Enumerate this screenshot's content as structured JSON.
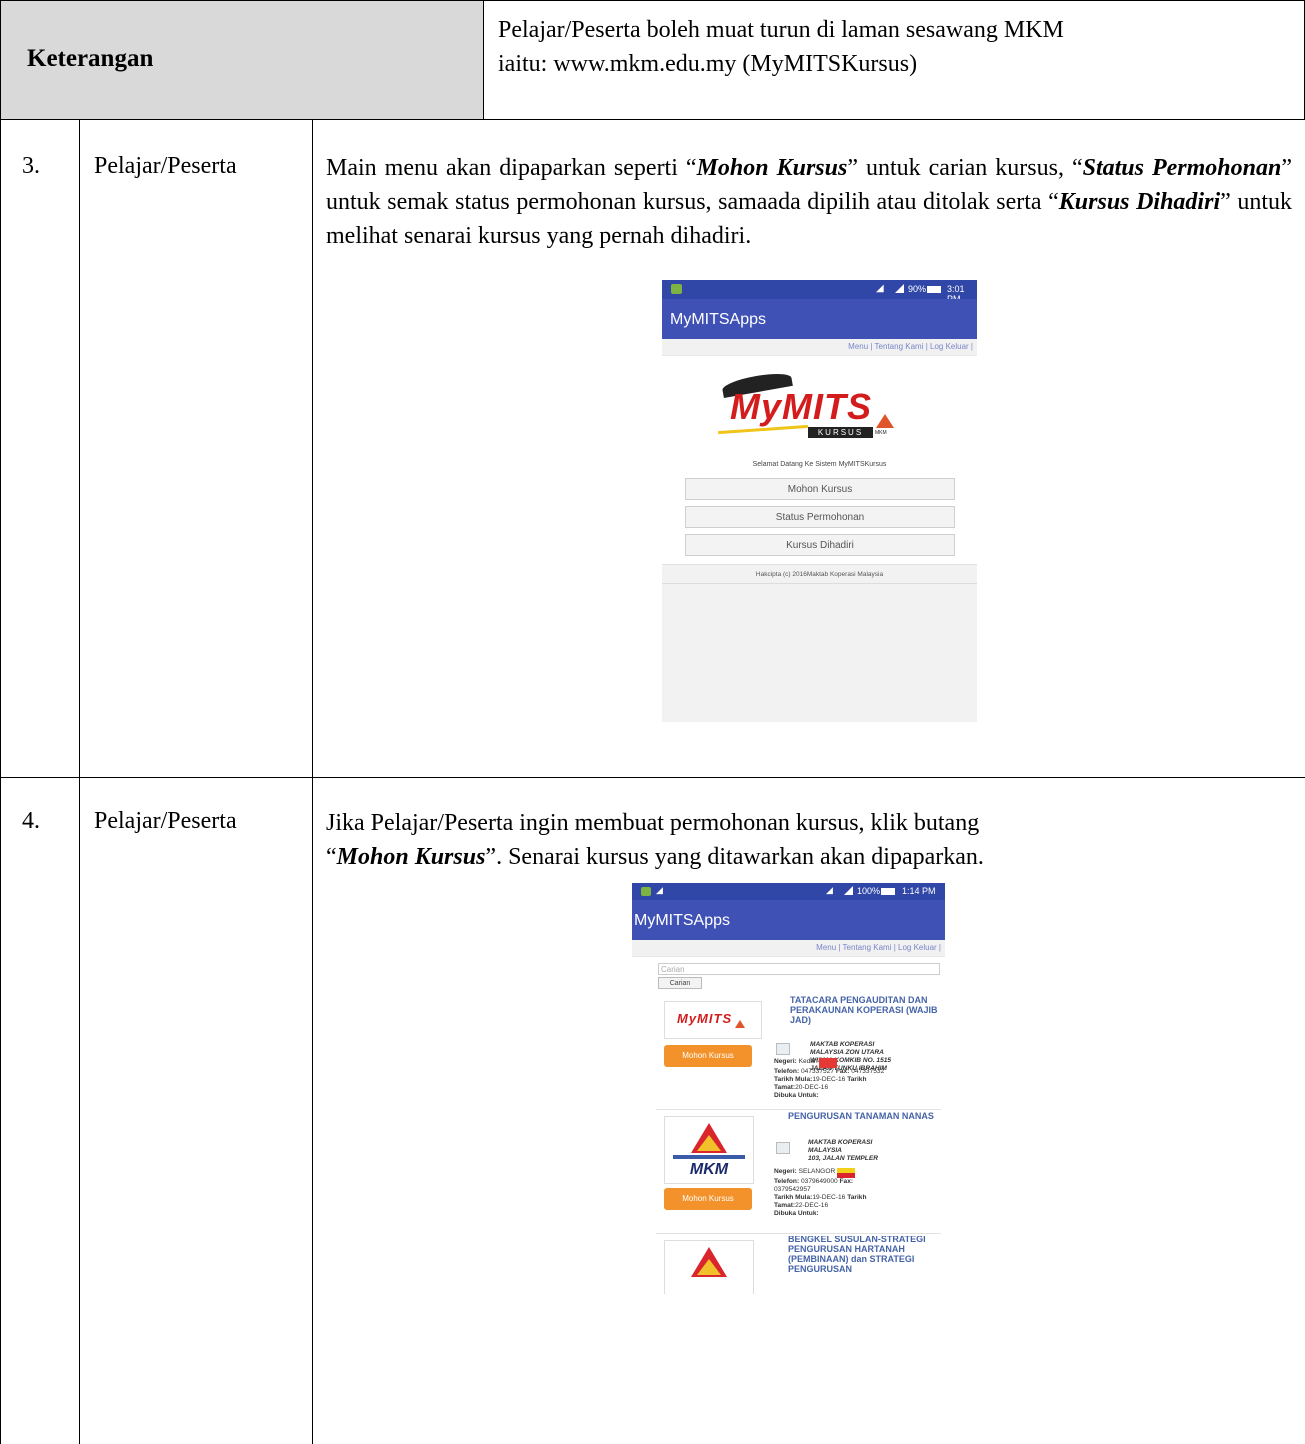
{
  "header": {
    "label": "Keterangan",
    "description_line1": "Pelajar/Peserta boleh muat turun di laman sesawang MKM",
    "description_line2": "iaitu: www.mkm.edu.my (MyMITSKursus)"
  },
  "rows": [
    {
      "number": "3.",
      "role": "Pelajar/Peserta",
      "text_parts": [
        "Main menu akan dipaparkan seperti “",
        "Mohon Kursus",
        "” untuk carian kursus, “",
        "Status Permohonan",
        "” untuk semak status permohonan kursus, samaada dipilih atau ditolak serta “",
        "Kursus Dihadiri",
        "” untuk melihat senarai kursus yang pernah dihadiri."
      ]
    },
    {
      "number": "4.",
      "role": "Pelajar/Peserta",
      "text_parts": [
        "Jika Pelajar/Peserta ingin membuat permohonan kursus, klik butang",
        "“",
        "Mohon Kursus",
        "”. Senarai kursus yang ditawarkan akan dipaparkan."
      ]
    }
  ],
  "phone1": {
    "status_battery": "90%",
    "status_time": "3:01 PM",
    "app_title": "MyMITSApps",
    "nav": [
      "Menu |",
      "Tentang Kami |",
      "Log Keluar |"
    ],
    "logo_main": "MyMITS",
    "logo_sub": "KURSUS",
    "logo_mkm": "MKM",
    "welcome": "Selamat Datang Ke Sistem MyMITSKursus",
    "buttons": [
      "Mohon Kursus",
      "Status Permohonan",
      "Kursus Dihadiri"
    ],
    "footer": "Hakcipta (c) 2016Maktab Koperasi Malaysia"
  },
  "phone2": {
    "status_battery": "100%",
    "status_time": "1:14 PM",
    "app_title": "MyMITSApps",
    "nav": [
      "Menu |",
      "Tentang Kami |",
      "Log Keluar |"
    ],
    "search_placeholder": "Carian",
    "search_button": "Carian",
    "courses": [
      {
        "title": "TATACARA PENGAUDITAN DAN PERAKAUNAN KOPERASI (WAJIB JAD)",
        "addr1": "MAKTAB KOPERASI",
        "addr2": "MALAYSIA ZON UTARA",
        "addr3": "WISMA KOMKIB NO. 1515",
        "addr4": "JALAN TUNKU IBRAHIM",
        "negeri": "Kedah",
        "telefon": "047337527",
        "fax": "047337532",
        "mula": "19-DEC-16",
        "tamat": "20-DEC-16",
        "button": "Mohon Kursus"
      },
      {
        "title": "PENGURUSAN TANAMAN NANAS",
        "addr1": "MAKTAB KOPERASI",
        "addr2": "MALAYSIA",
        "addr3": "103, JALAN TEMPLER",
        "addr4": "",
        "negeri": "SELANGOR",
        "telefon": "0379649000",
        "fax": "0379542957",
        "mula": "19-DEC-16",
        "tamat": "22-DEC-16",
        "button": "Mohon Kursus"
      },
      {
        "title": "BENGKEL SUSULAN-STRATEGI PENGURUSAN HARTANAH (PEMBINAAN) dan STRATEGI PENGURUSAN"
      }
    ],
    "lbl_negeri": "Negeri:",
    "lbl_telefon": "Telefon:",
    "lbl_fax": "Fax:",
    "lbl_mula": "Tarikh Mula:",
    "lbl_tarikh": "Tarikh",
    "lbl_tamat": "Tamat:",
    "lbl_dibuka": "Dibuka Untuk:",
    "logo_mkm": "MKM"
  }
}
